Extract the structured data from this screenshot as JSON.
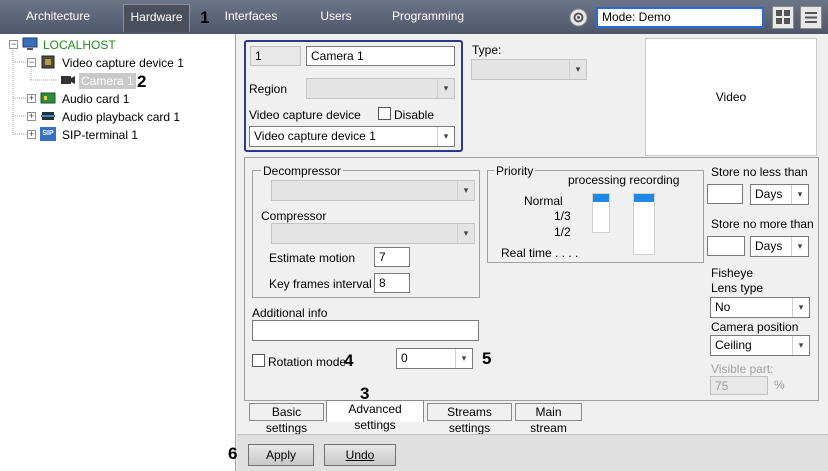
{
  "header": {
    "tabs": [
      "Architecture",
      "Hardware",
      "Interfaces",
      "Users",
      "Programming"
    ],
    "mode": "Mode: Demo"
  },
  "annotations": {
    "n1": "1",
    "n2": "2",
    "n3": "3",
    "n4": "4",
    "n5": "5",
    "n6": "6"
  },
  "tree": {
    "root": "LOCALHOST",
    "device": "Video capture device 1",
    "camera": "Camera 1",
    "audio": "Audio card 1",
    "playback": "Audio playback card 1",
    "sip": "SIP-terminal 1",
    "sip_icon": "SIP"
  },
  "camera": {
    "id": "1",
    "name": "Camera 1",
    "region_label": "Region",
    "region_value": "",
    "vcd_label": "Video capture device",
    "disable_label": "Disable",
    "vcd_value": "Video capture device 1",
    "type_label": "Type:",
    "type_value": "",
    "video_label": "Video"
  },
  "advanced": {
    "decompressor_label": "Decompressor",
    "compressor_label": "Compressor",
    "estimate_label": "Estimate motion",
    "estimate_value": "7",
    "keyframes_label": "Key frames interval",
    "keyframes_value": "8",
    "priority_label": "Priority",
    "priority_cols": "processing recording",
    "prio_normal": "Normal",
    "prio_third": "1/3",
    "prio_half": "1/2",
    "prio_realtime": "Real time . . . .",
    "store_min_label": "Store no less than",
    "store_min_unit": "Days",
    "store_max_label": "Store no more than",
    "store_max_unit": "Days",
    "fisheye_label": "Fisheye",
    "lens_label": "Lens type",
    "lens_value": "No",
    "campos_label": "Camera position",
    "campos_value": "Ceiling",
    "visible_label": "Visible part:",
    "visible_value": "75",
    "visible_unit": "%",
    "additional_label": "Additional info",
    "additional_value": "",
    "rotation_label": "Rotation mode",
    "rotation_value": "0"
  },
  "bottom_tabs": [
    "Basic settings",
    "Advanced settings",
    "Streams settings",
    "Main stream"
  ],
  "buttons": {
    "apply": "Apply",
    "undo": "Undo"
  }
}
